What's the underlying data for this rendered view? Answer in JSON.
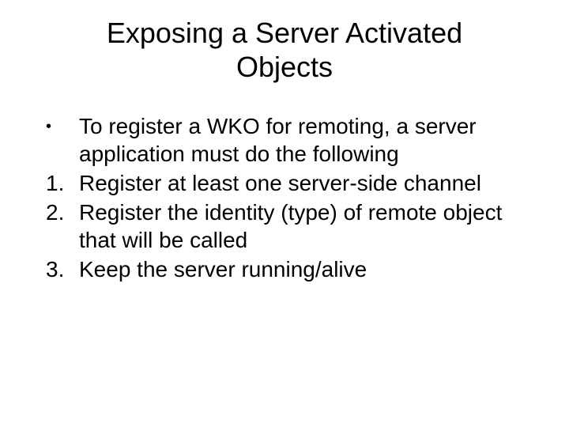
{
  "title": "Exposing a Server Activated Objects",
  "items": [
    {
      "marker": "•",
      "text": "To register a WKO for remoting, a server application must do the following",
      "isBullet": true
    },
    {
      "marker": "1.",
      "text": "Register at least one server-side channel",
      "isBullet": false
    },
    {
      "marker": "2.",
      "text": "Register the identity (type) of remote object that will be called",
      "isBullet": false
    },
    {
      "marker": "3.",
      "text": "Keep the server running/alive",
      "isBullet": false
    }
  ]
}
